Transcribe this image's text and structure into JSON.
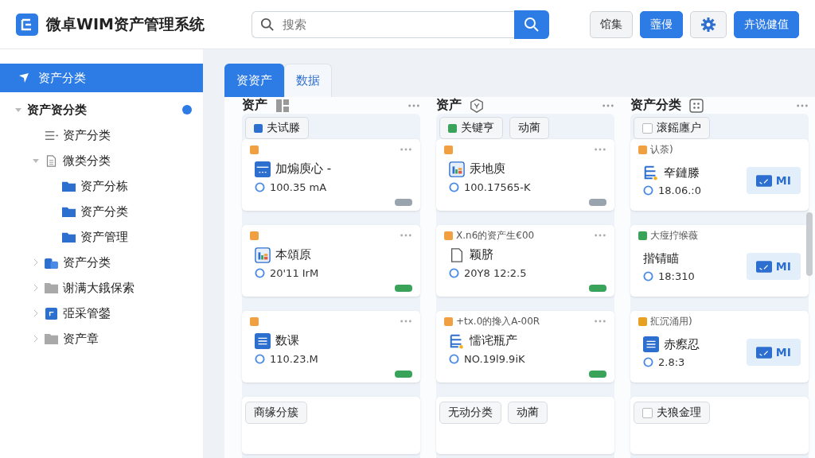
{
  "header": {
    "title": "微卓WIM资产管理系统",
    "search": {
      "placeholder": "搜索"
    },
    "buttons": [
      {
        "kind": "plain",
        "label": "馆集"
      },
      {
        "kind": "primary",
        "label": "虀僈"
      },
      {
        "kind": "gear"
      },
      {
        "kind": "primary",
        "label": "卉说健值"
      }
    ]
  },
  "sidebar": {
    "top_item": {
      "label": "资产分类",
      "selected": true
    },
    "tree": [
      {
        "label": "资产资分类",
        "expanded": true,
        "badge": true,
        "children": [
          {
            "label": "资产分类",
            "kind": "list"
          },
          {
            "label": "微类分类",
            "kind": "doc",
            "expanded": true,
            "children": [
              {
                "label": "资产分栋",
                "kind": "folder"
              },
              {
                "label": "资产分类",
                "kind": "folder"
              },
              {
                "label": "资产管理",
                "kind": "folder"
              }
            ]
          },
          {
            "label": "资产分类",
            "kind": "apps",
            "expanded": false
          },
          {
            "label": "谢满大鋨保索",
            "kind": "grayfolder",
            "expanded": false
          },
          {
            "label": "弫采管鎣",
            "kind": "square",
            "expanded": false
          },
          {
            "label": "资产章",
            "kind": "grayfolder",
            "expanded": false
          }
        ]
      }
    ]
  },
  "tabs": [
    {
      "label": "资资产",
      "selected": true
    },
    {
      "label": "数据",
      "selected": false
    }
  ],
  "columns": [
    {
      "title": "资产",
      "kind": "grid",
      "chips": [
        {
          "label": "夫试滕",
          "kind": "blue"
        }
      ],
      "cards": [
        {
          "color": "#f0a040",
          "kind": "bar",
          "title": "加煽庾心 -",
          "reading": "100.35 mA",
          "badge": {
            "color": "#9aa4ae"
          }
        },
        {
          "color": "#f0a040",
          "kind": "chart",
          "title": "本頌原",
          "reading": "20'11 IrM",
          "badge": {
            "color": "#3aa35a"
          }
        },
        {
          "color": "#f0a040",
          "kind": "list",
          "title": "数课",
          "reading": "110.23.M",
          "badge": {
            "color": "#3aa35a"
          }
        }
      ],
      "bottom_chips": [
        {
          "label": "商缘分簇",
          "kind": "none"
        }
      ]
    },
    {
      "title": "资产",
      "kind": "shield",
      "chips": [
        {
          "label": "关键亨",
          "kind": "green"
        },
        {
          "label": "动蔺",
          "kind": "none"
        }
      ],
      "cards": [
        {
          "color": "#f0a040",
          "kind": "chart",
          "title": "汞地庾",
          "reading": "100.17565-K",
          "badge": {
            "color": "#9aa4ae"
          }
        },
        {
          "color": "#f0a040",
          "subtitle": "X.n6的资产生€00",
          "kind": "doc",
          "title": "颖脐",
          "reading": "20Y8 12:2.5",
          "badge": {
            "color": "#3aa35a"
          }
        },
        {
          "color": "#f0a040",
          "subtitle": "+tx.0的搀入A-00R",
          "kind": "server",
          "title": "懦诧瓶产",
          "reading": "NO.19l9.9iK",
          "badge": {
            "color": "#3aa35a"
          }
        }
      ],
      "bottom_chips": [
        {
          "label": "无动分类",
          "kind": "none"
        },
        {
          "label": "动蔺",
          "kind": "none"
        }
      ]
    },
    {
      "title": "资产分类",
      "kind": "dots",
      "chips": [
        {
          "label": "滚鎐廛户",
          "kind": "box"
        }
      ],
      "cards": [
        {
          "color": "#f0a040",
          "subtitle": "认荼)",
          "kind": "server",
          "title": "㚔鏈滕",
          "reading": "18.06.:0",
          "action": "MI"
        },
        {
          "color": "#3aa35a",
          "subtitle": "大痖拧缑薇",
          "kind": "none",
          "title": "揩锖瞄",
          "reading": "18:310",
          "action": "MI"
        },
        {
          "color": "#e8a020",
          "subtitle": "㧟沉涌用)",
          "kind": "list",
          "title": "赤瘵忍",
          "reading": "2.8:3",
          "action": "MI"
        }
      ],
      "bottom_chips": [
        {
          "label": "夫狼金理",
          "kind": "box"
        }
      ]
    }
  ]
}
